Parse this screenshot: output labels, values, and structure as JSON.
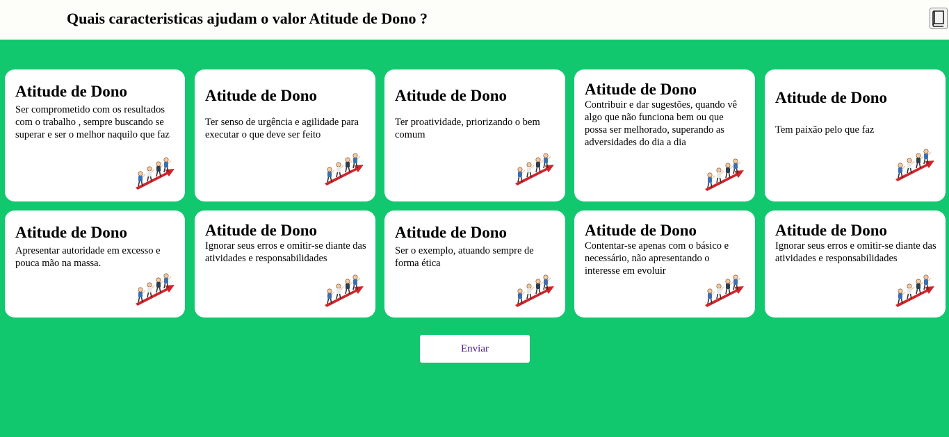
{
  "header": {
    "question": "Quais caracteristicas ajudam o valor Atitude de Dono ?",
    "book_icon": "book-icon"
  },
  "cards": [
    {
      "title": "Atitude de Dono",
      "text": "Ser comprometido com os resultados com o trabalho , sempre buscando se superar e ser o melhor naquilo que faz",
      "icon": "team-climbing-arrow-illustration"
    },
    {
      "title": "Atitude de Dono",
      "text": "Ter senso de urgência e agilidade para executar o que deve ser feito",
      "icon": "team-climbing-arrow-illustration"
    },
    {
      "title": "Atitude de Dono",
      "text": "Ter proatividade, priorizando o bem comum",
      "icon": "team-climbing-arrow-illustration"
    },
    {
      "title": "Atitude de Dono",
      "text": "Contribuir e dar sugestões, quando vê algo que não funciona bem ou que possa ser melhorado, superando as adversidades do dia a dia",
      "icon": "team-climbing-arrow-illustration"
    },
    {
      "title": "Atitude de Dono",
      "text": "Tem paixão pelo que faz",
      "icon": "team-climbing-arrow-illustration"
    },
    {
      "title": "Atitude de Dono",
      "text": "Apresentar autoridade em excesso e pouca mão na massa.",
      "icon": "team-climbing-arrow-illustration"
    },
    {
      "title": "Atitude de Dono",
      "text": "Ignorar seus erros e omitir-se diante das atividades e responsabilidades",
      "icon": "team-climbing-arrow-illustration"
    },
    {
      "title": "Atitude de Dono",
      "text": "Ser o exemplo, atuando sempre de forma ética",
      "icon": "team-climbing-arrow-illustration"
    },
    {
      "title": "Atitude de Dono",
      "text": "Contentar-se apenas com o básico e necessário, não apresentando o interesse em evoluir",
      "icon": "team-climbing-arrow-illustration"
    },
    {
      "title": "Atitude de Dono",
      "text": "Ignorar seus erros e omitir-se diante das atividades e responsabilidades",
      "icon": "team-climbing-arrow-illustration"
    }
  ],
  "actions": {
    "send_label": "Enviar"
  },
  "colors": {
    "background": "#12c86f",
    "card": "#ffffff",
    "arrow": "#d2232a",
    "button_text": "#4b1a86"
  }
}
